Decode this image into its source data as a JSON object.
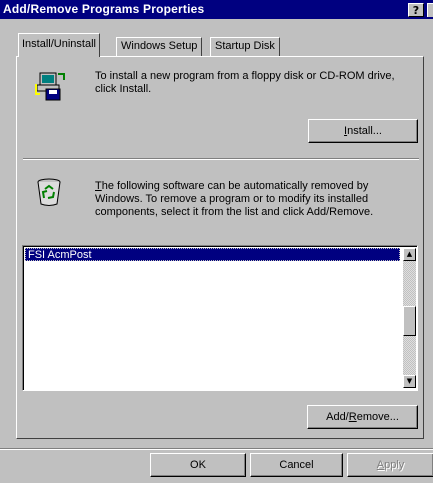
{
  "window": {
    "title": "Add/Remove Programs Properties",
    "help_label": "?"
  },
  "tabs": [
    {
      "label": "Install/Uninstall",
      "active": true
    },
    {
      "label": "Windows Setup",
      "active": false
    },
    {
      "label": "Startup Disk",
      "active": false
    }
  ],
  "install": {
    "icon": "floppy-disk-install-icon",
    "description": "To install a new program from a floppy disk or CD-ROM drive, click Install.",
    "button": {
      "mnemonic": "I",
      "rest": "nstall..."
    }
  },
  "remove": {
    "icon": "recycle-bin-icon",
    "description_mnemonic": "T",
    "description_rest": "he following software can be automatically removed by Windows. To remove a program or to modify its installed components, select it from the list and click Add/Remove.",
    "list_items": [
      "FSI AcmPost"
    ],
    "button": {
      "before": "Add/",
      "mnemonic": "R",
      "after": "emove..."
    }
  },
  "footer": {
    "ok": "OK",
    "cancel": "Cancel",
    "apply": {
      "mnemonic": "A",
      "rest": "pply"
    }
  }
}
